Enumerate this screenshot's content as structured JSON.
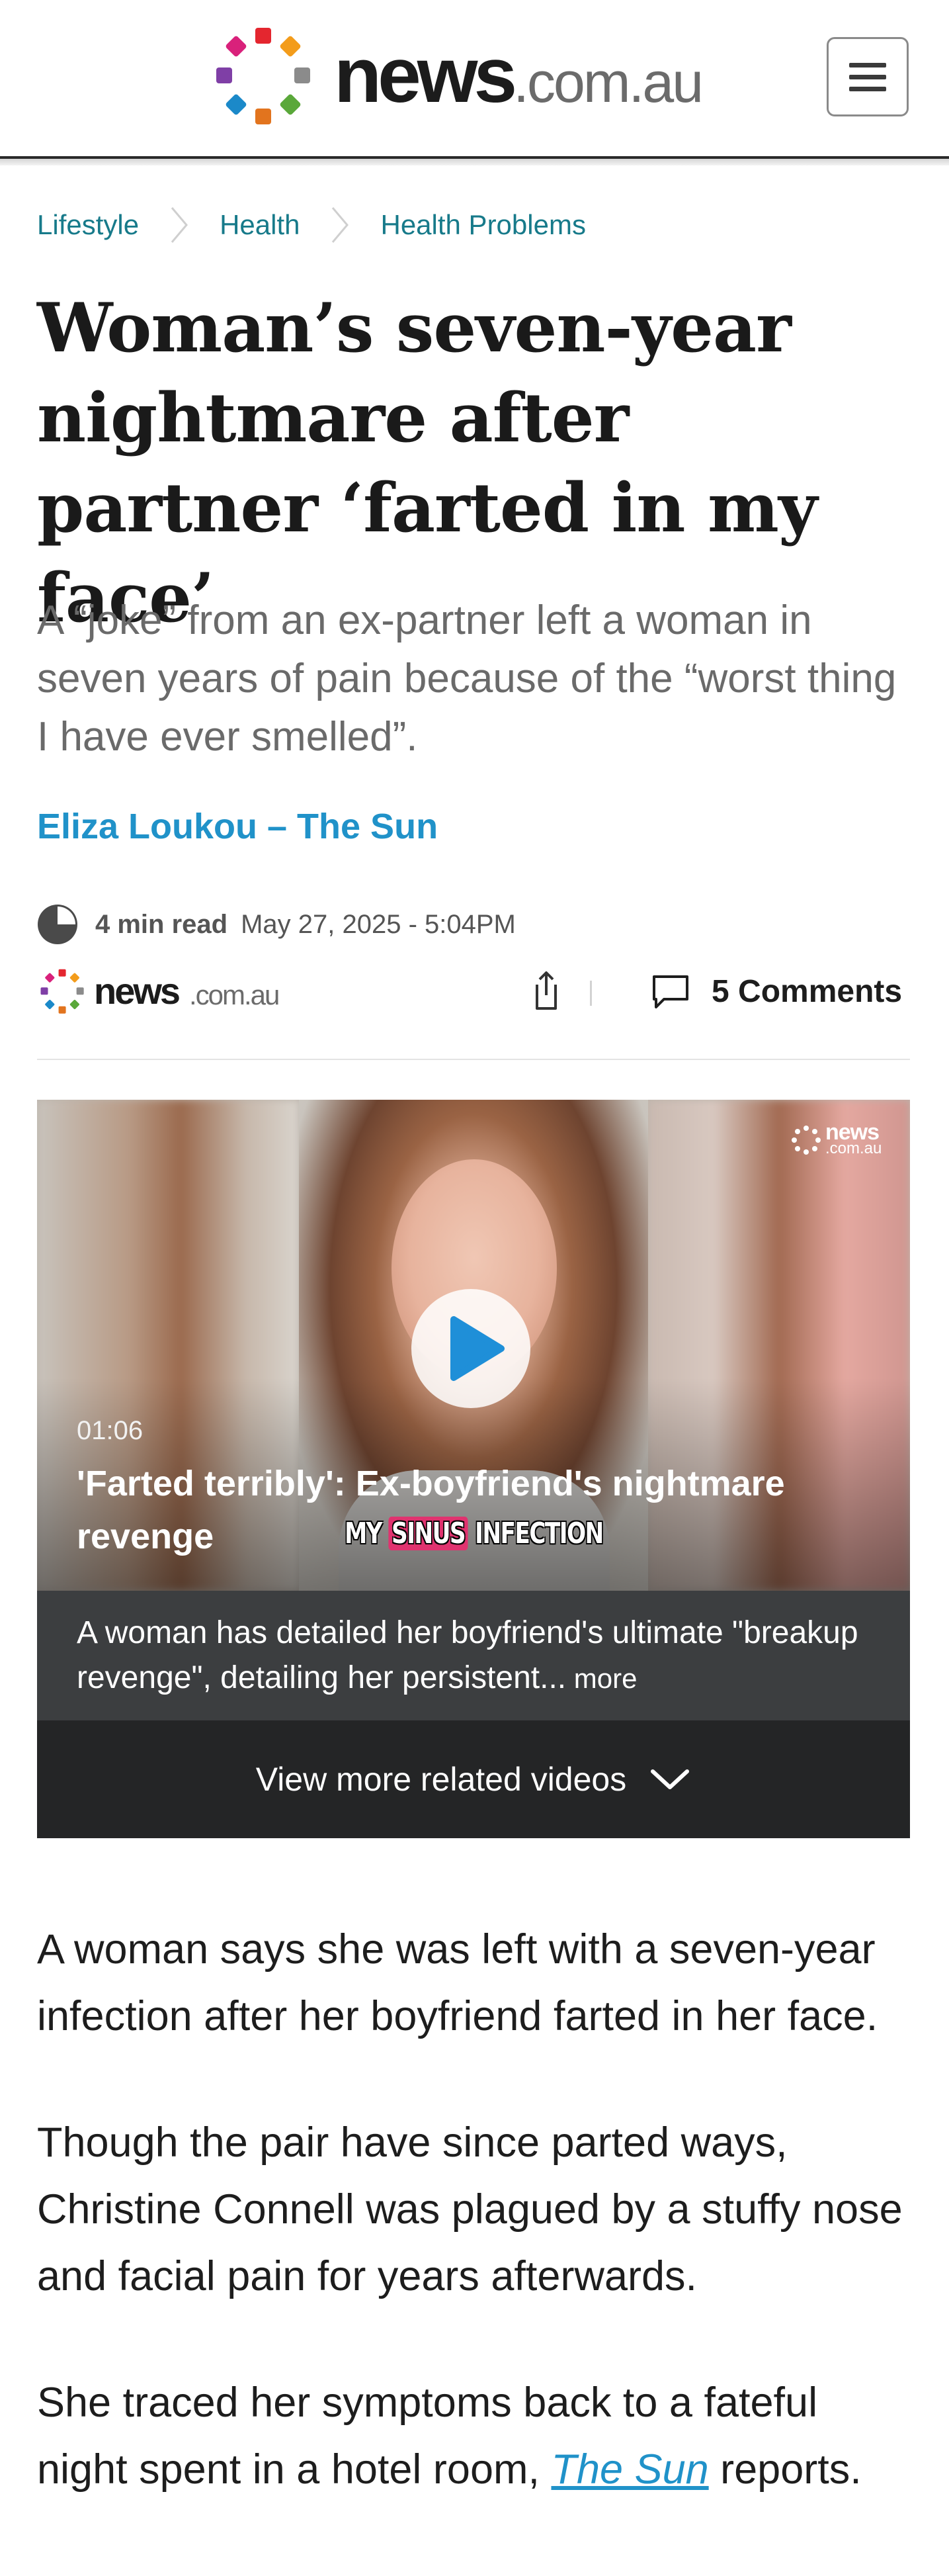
{
  "header": {
    "logo_news": "news",
    "logo_domain": ".com.au",
    "menu_icon": "hamburger-menu-icon"
  },
  "breadcrumb": [
    "Lifestyle",
    "Health",
    "Health Problems"
  ],
  "article": {
    "headline": "Woman’s seven-year nightmare after partner ‘farted in my face’",
    "standfirst": "A “joke” from an ex-partner left a woman in seven years of pain because of the “worst thing I have ever smelled”.",
    "byline": "Eliza Loukou – The Sun",
    "read_time": "4 min read",
    "published": "May 27, 2025 - 5:04PM",
    "publisher_news": "news",
    "publisher_domain": ".com.au",
    "comments_label": "5 Comments"
  },
  "video": {
    "duration": "01:06",
    "title": "'Farted terribly': Ex-boyfriend's nightmare revenge",
    "caption_before": "MY ",
    "caption_highlight": "SINUS",
    "caption_after": " INFECTION",
    "watermark_news": "news",
    "watermark_domain": ".com.au",
    "description": "A woman has detailed her boyfriend's ultimate \"breakup revenge\", detailing her persistent...",
    "more_label": " more",
    "more_videos_label": "View more related videos"
  },
  "body": {
    "p1": "A woman says she was left with a seven-year infection after her boyfriend farted in her face.",
    "p2": "Though the pair have since parted ways, Christine Connell was plagued by a stuffy nose and facial pain for years afterwards.",
    "p3_before": "She traced her symptoms back to a fateful night spent in a hotel room, ",
    "p3_link": "The Sun",
    "p3_after": " reports."
  },
  "colors": {
    "accent_teal": "#177a8a",
    "byline_blue": "#2092c9",
    "video_dark": "#242526"
  }
}
